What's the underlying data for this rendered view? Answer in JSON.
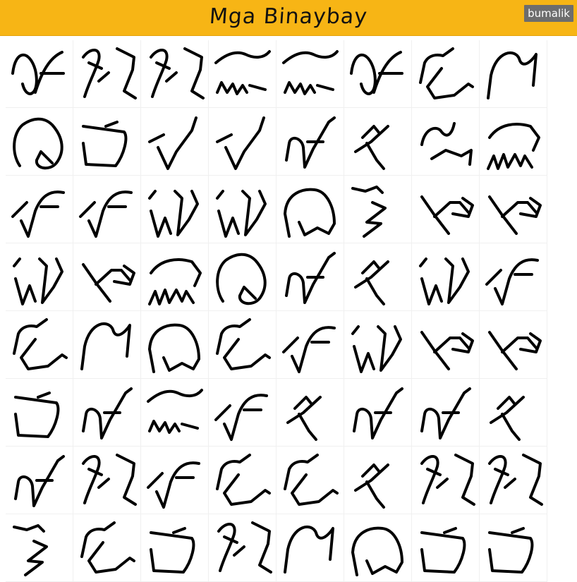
{
  "header": {
    "title": "Mga Binaybay",
    "brand": "bumalik",
    "accent_color": "#f7b515"
  },
  "grid": {
    "columns": 8,
    "cells": [
      {
        "char": "a"
      },
      {
        "char": "e/i"
      },
      {
        "char": "e/i"
      },
      {
        "char": "o/u"
      },
      {
        "char": "o/u"
      },
      {
        "char": "a"
      },
      {
        "char": "ka"
      },
      {
        "char": "ga"
      },
      {
        "char": "nga"
      },
      {
        "char": "ta"
      },
      {
        "char": "da"
      },
      {
        "char": "da"
      },
      {
        "char": "na"
      },
      {
        "char": "pa"
      },
      {
        "char": "ba"
      },
      {
        "char": "ma"
      },
      {
        "char": "ya"
      },
      {
        "char": "ya"
      },
      {
        "char": "la"
      },
      {
        "char": "la"
      },
      {
        "char": "wa"
      },
      {
        "char": "sa"
      },
      {
        "char": "ha"
      },
      {
        "char": "ha"
      },
      {
        "char": "la"
      },
      {
        "char": "ha"
      },
      {
        "char": "ma"
      },
      {
        "char": "nga"
      },
      {
        "char": "na"
      },
      {
        "char": "pa"
      },
      {
        "char": "la"
      },
      {
        "char": "ya"
      },
      {
        "char": "ka"
      },
      {
        "char": "ga"
      },
      {
        "char": "wa"
      },
      {
        "char": "ka"
      },
      {
        "char": "ya"
      },
      {
        "char": "la"
      },
      {
        "char": "ha"
      },
      {
        "char": "ha"
      },
      {
        "char": "ta"
      },
      {
        "char": "na"
      },
      {
        "char": "o/u"
      },
      {
        "char": "ya"
      },
      {
        "char": "pa"
      },
      {
        "char": "na"
      },
      {
        "char": "na"
      },
      {
        "char": "pa"
      },
      {
        "char": "na"
      },
      {
        "char": "e/i"
      },
      {
        "char": "ya"
      },
      {
        "char": "ka"
      },
      {
        "char": "ka"
      },
      {
        "char": "pa"
      },
      {
        "char": "e/i"
      },
      {
        "char": "e/i"
      },
      {
        "char": "sa"
      },
      {
        "char": "ka"
      },
      {
        "char": "ta"
      },
      {
        "char": "e/i"
      },
      {
        "char": "ga"
      },
      {
        "char": "wa"
      },
      {
        "char": "ta"
      },
      {
        "char": "ta"
      }
    ]
  }
}
